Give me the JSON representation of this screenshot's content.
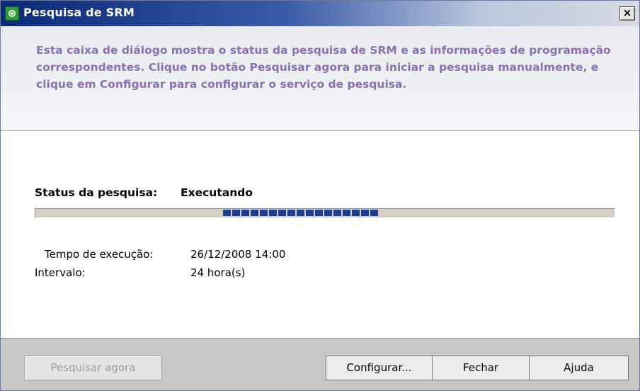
{
  "window": {
    "title": "Pesquisa de SRM",
    "close_label": "×"
  },
  "header": {
    "description": "Esta caixa de diálogo mostra o status da pesquisa de SRM e as informações de programação correspondentes. Clique no botão Pesquisar agora para iniciar a pesquisa manualmente, e clique em Configurar para configurar o serviço de pesquisa."
  },
  "status": {
    "label": "Status da pesquisa:",
    "value": "Executando",
    "progress_blocks": 17
  },
  "details": {
    "execution_time_label": "Tempo de execução:",
    "execution_time_value": "26/12/2008 14:00",
    "interval_label": "Intervalo:",
    "interval_value": "24 hora(s)"
  },
  "buttons": {
    "search_now": "Pesquisar agora",
    "configure": "Configurar...",
    "close": "Fechar",
    "help": "Ajuda"
  },
  "colors": {
    "header_text": "#8a72b0",
    "progress_block": "#1e3e8c",
    "title_bar": "#0a2a78"
  },
  "icons": {
    "title_icon": "srm-search-icon",
    "close_icon": "close-icon"
  }
}
